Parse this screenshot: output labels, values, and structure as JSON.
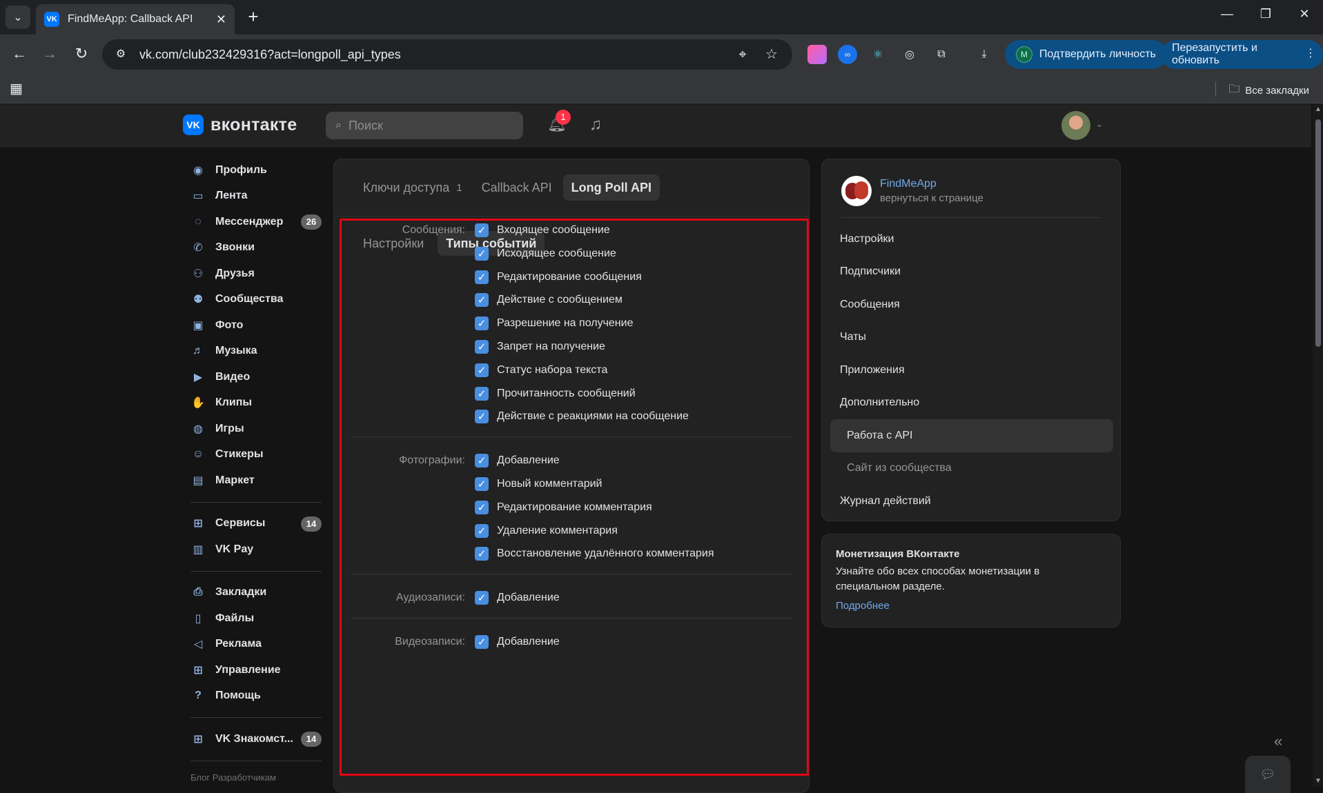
{
  "browser": {
    "tab_title": "FindMeApp: Callback API",
    "tab_favicon": "VK",
    "url": "vk.com/club232429316?act=longpoll_api_types",
    "verify_label": "Подтвердить личность",
    "verify_avatar": "M",
    "relaunch_label": "Перезапустить и обновить",
    "bookmarks_all": "Все закладки"
  },
  "vk": {
    "logo_text": "вконтакте",
    "logo_mark": "VK",
    "search_placeholder": "Поиск",
    "notif_count": "1"
  },
  "leftnav": {
    "items": [
      {
        "label": "Профиль",
        "icon": "profile-icon"
      },
      {
        "label": "Лента",
        "icon": "feed-icon"
      },
      {
        "label": "Мессенджер",
        "icon": "messenger-icon",
        "count": "26"
      },
      {
        "label": "Звонки",
        "icon": "phone-icon"
      },
      {
        "label": "Друзья",
        "icon": "friends-icon"
      },
      {
        "label": "Сообщества",
        "icon": "communities-icon"
      },
      {
        "label": "Фото",
        "icon": "photo-icon"
      },
      {
        "label": "Музыка",
        "icon": "music-icon"
      },
      {
        "label": "Видео",
        "icon": "video-icon"
      },
      {
        "label": "Клипы",
        "icon": "clips-icon"
      },
      {
        "label": "Игры",
        "icon": "games-icon"
      },
      {
        "label": "Стикеры",
        "icon": "stickers-icon"
      },
      {
        "label": "Маркет",
        "icon": "market-icon"
      }
    ],
    "services": [
      {
        "label": "Сервисы",
        "icon": "services-icon",
        "count": "14"
      },
      {
        "label": "VK Pay",
        "icon": "wallet-icon"
      }
    ],
    "other": [
      {
        "label": "Закладки",
        "icon": "bookmark-icon"
      },
      {
        "label": "Файлы",
        "icon": "file-icon"
      },
      {
        "label": "Реклама",
        "icon": "megaphone-icon"
      },
      {
        "label": "Управление",
        "icon": "manage-icon"
      },
      {
        "label": "Помощь",
        "icon": "help-icon"
      }
    ],
    "apps": [
      {
        "label": "VK Знакомст...",
        "icon": "apps-icon",
        "count": "14"
      }
    ],
    "footer": "Блог   Разработчикам"
  },
  "center": {
    "tabs": [
      {
        "label": "Ключи доступа",
        "count": "1"
      },
      {
        "label": "Callback API"
      },
      {
        "label": "Long Poll API"
      }
    ],
    "subtabs": [
      "Настройки",
      "Типы событий"
    ],
    "groups": [
      {
        "label": "Сообщения:",
        "items": [
          "Входящее сообщение",
          "Исходящее сообщение",
          "Редактирование сообщения",
          "Действие с сообщением",
          "Разрешение на получение",
          "Запрет на получение",
          "Статус набора текста",
          "Прочитанность сообщений",
          "Действие с реакциями на сообщение"
        ]
      },
      {
        "label": "Фотографии:",
        "items": [
          "Добавление",
          "Новый комментарий",
          "Редактирование комментария",
          "Удаление комментария",
          "Восстановление удалённого комментария"
        ]
      },
      {
        "label": "Аудиозаписи:",
        "items": [
          "Добавление"
        ]
      },
      {
        "label": "Видеозаписи:",
        "items": [
          "Добавление"
        ]
      }
    ]
  },
  "right": {
    "club_name": "FindMeApp",
    "club_back": "вернуться к странице",
    "menu": [
      "Настройки",
      "Подписчики",
      "Сообщения",
      "Чаты",
      "Приложения",
      "Дополнительно",
      "Работа с API",
      "Сайт из сообщества",
      "Журнал действий"
    ],
    "monet_title": "Монетизация ВКонтакте",
    "monet_desc": "Узнайте обо всех способах монетизации в специальном разделе.",
    "monet_link": "Подробнее"
  },
  "colors": {
    "accent": "#0077ff",
    "highlight_border": "#e30613",
    "checkbox": "#4a8ee0",
    "link": "#71aaeb"
  }
}
